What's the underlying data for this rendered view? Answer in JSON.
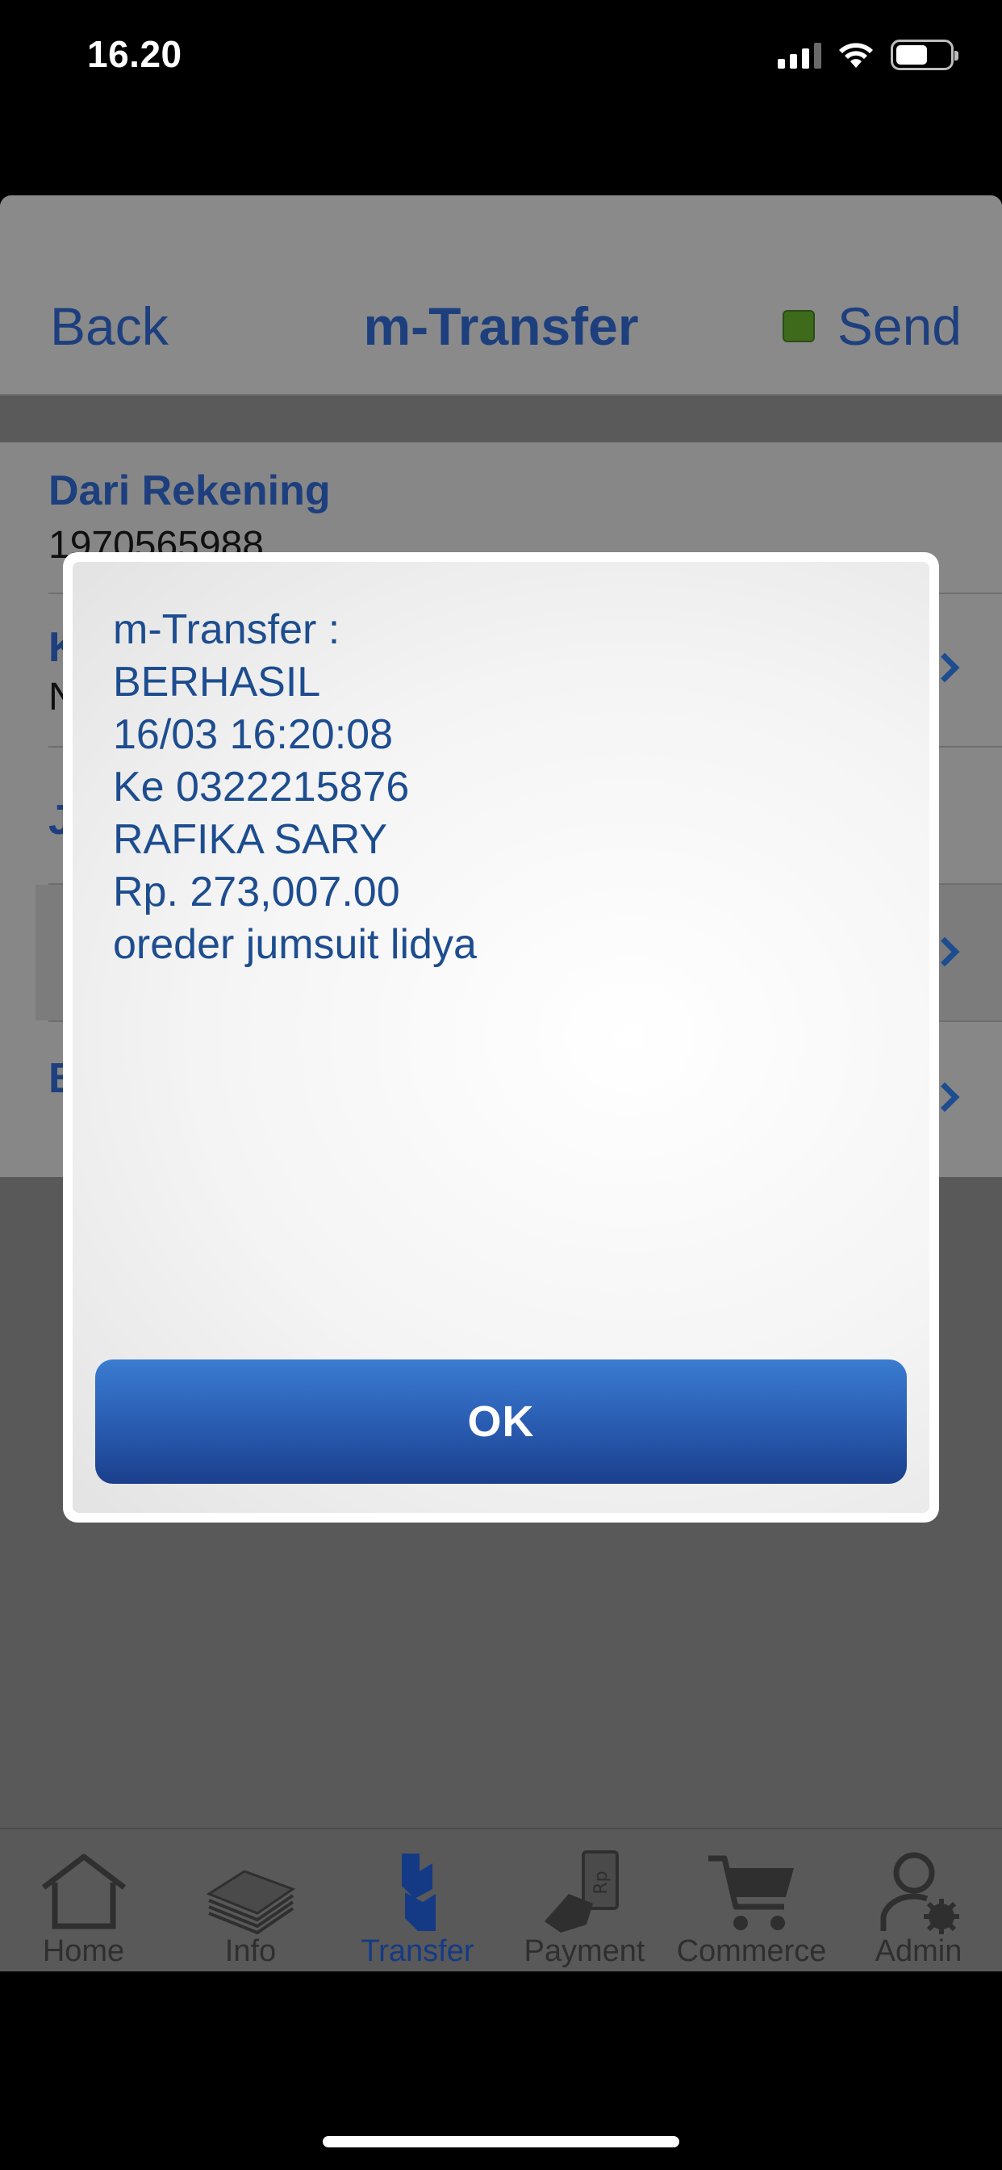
{
  "status_bar": {
    "time": "16.20",
    "icons": [
      "cellular-signal-icon",
      "wifi-icon",
      "battery-icon"
    ]
  },
  "navbar": {
    "back_label": "Back",
    "title": "m-Transfer",
    "send_label": "Send",
    "send_indicator_color": "#3d6a1b"
  },
  "form": {
    "rows": [
      {
        "label": "Dari Rekening",
        "value": "1970565988"
      },
      {
        "label": "K",
        "value": "N"
      },
      {
        "label": "J",
        "value": ""
      },
      {
        "label": "",
        "value": ""
      },
      {
        "label": "B",
        "value": ""
      }
    ]
  },
  "modal": {
    "lines": [
      "m-Transfer :",
      "BERHASIL",
      "16/03 16:20:08",
      "Ke 0322215876",
      "RAFIKA SARY",
      "Rp. 273,007.00",
      "oreder jumsuit lidya"
    ],
    "ok_label": "OK"
  },
  "tabbar": {
    "active": "Transfer",
    "items": [
      {
        "label": "Home",
        "icon": "home-icon"
      },
      {
        "label": "Info",
        "icon": "info-stack-icon"
      },
      {
        "label": "Transfer",
        "icon": "transfer-icon"
      },
      {
        "label": "Payment",
        "icon": "payment-hand-icon"
      },
      {
        "label": "Commerce",
        "icon": "cart-icon"
      },
      {
        "label": "Admin",
        "icon": "admin-user-gear-icon"
      }
    ]
  },
  "colors": {
    "accent": "#1d4d8f",
    "ok_button": "#2a5eb3",
    "overlay": "#595959"
  }
}
